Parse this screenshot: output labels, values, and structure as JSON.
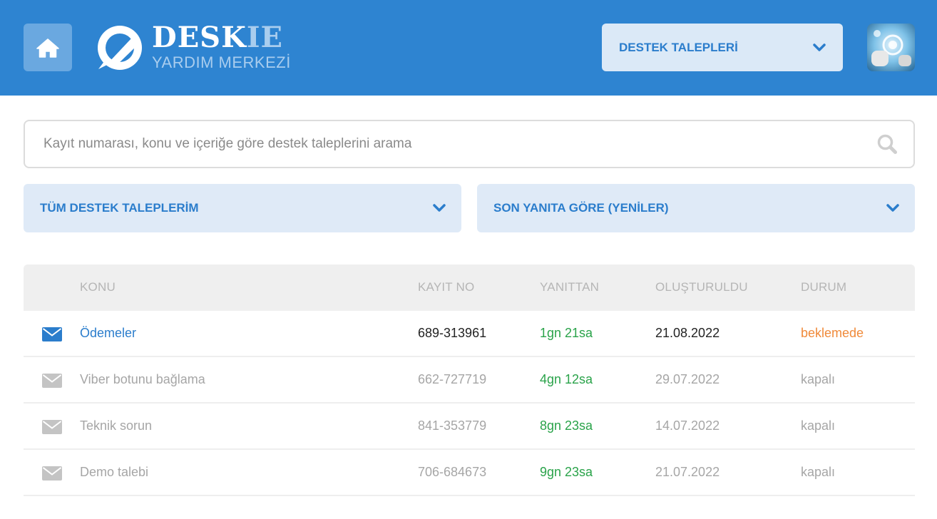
{
  "header": {
    "logo_main": "DESK",
    "logo_accent": "IE",
    "logo_subtitle": "YARDIM MERKEZİ",
    "nav_select": "DESTEK TALEPLERİ",
    "home_icon": "home-icon",
    "avatar_icon": "user-avatar"
  },
  "search": {
    "placeholder": "Kayıt numarası, konu ve içeriğe göre destek taleplerini arama",
    "icon": "search-icon"
  },
  "filters": {
    "scope": "TÜM DESTEK TALEPLERİM",
    "sort": "SON YANITA GÖRE (YENİLER)"
  },
  "table": {
    "headers": {
      "subject": "KONU",
      "ticket_no": "KAYIT NO",
      "since_reply": "YANITTAN",
      "created": "OLUŞTURULDU",
      "status": "DURUM"
    },
    "rows": [
      {
        "subject": "Ödemeler",
        "ticket_no": "689-313961",
        "since_reply": "1gn 21sa",
        "created": "21.08.2022",
        "status": "beklemede"
      },
      {
        "subject": "Viber botunu bağlama",
        "ticket_no": "662-727719",
        "since_reply": "4gn 12sa",
        "created": "29.07.2022",
        "status": "kapalı"
      },
      {
        "subject": "Teknik sorun",
        "ticket_no": "841-353779",
        "since_reply": "8gn 23sa",
        "created": "14.07.2022",
        "status": "kapalı"
      },
      {
        "subject": "Demo talebi",
        "ticket_no": "706-684673",
        "since_reply": "9gn 23sa",
        "created": "21.07.2022",
        "status": "kapalı"
      }
    ]
  },
  "colors": {
    "brand_blue": "#2e84d1",
    "status_pending": "#f08a3a",
    "time_green": "#2aa34a",
    "muted_gray": "#a6a6a6"
  }
}
